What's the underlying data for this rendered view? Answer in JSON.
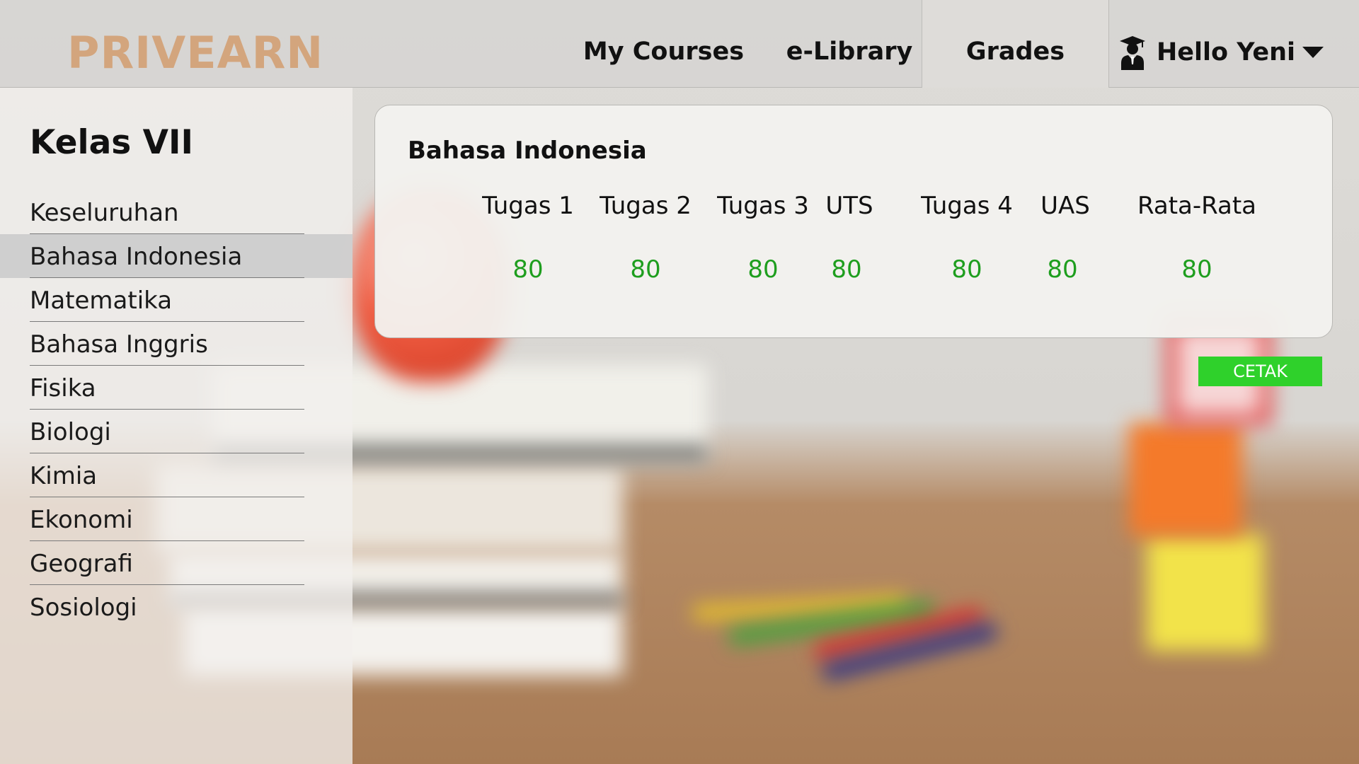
{
  "app": {
    "logo": "PRIVEARN"
  },
  "nav": {
    "my_courses": "My Courses",
    "elibrary": "e-Library",
    "grades": "Grades",
    "user_greeting": "Hello Yeni"
  },
  "sidebar": {
    "title": "Kelas VII",
    "items": [
      {
        "label": "Keseluruhan",
        "active": false
      },
      {
        "label": "Bahasa Indonesia",
        "active": true
      },
      {
        "label": "Matematika",
        "active": false
      },
      {
        "label": "Bahasa Inggris",
        "active": false
      },
      {
        "label": "Fisika",
        "active": false
      },
      {
        "label": "Biologi",
        "active": false
      },
      {
        "label": "Kimia",
        "active": false
      },
      {
        "label": "Ekonomi",
        "active": false
      },
      {
        "label": "Geografi",
        "active": false
      },
      {
        "label": "Sosiologi",
        "active": false
      }
    ]
  },
  "grades": {
    "subject": "Bahasa Indonesia",
    "columns": [
      "Tugas 1",
      "Tugas 2",
      "Tugas 3",
      "UTS",
      "Tugas 4",
      "UAS",
      "Rata-Rata"
    ],
    "values": [
      "80",
      "80",
      "80",
      "80",
      "80",
      "80",
      "80"
    ]
  },
  "actions": {
    "print_label": "CETAK"
  },
  "colors": {
    "logo": "#d3a57d",
    "grade_value": "#1e9e1e",
    "print_button": "#2fd12b"
  },
  "icons": {
    "avatar": "graduate-user-icon",
    "caret": "caret-down-icon"
  }
}
